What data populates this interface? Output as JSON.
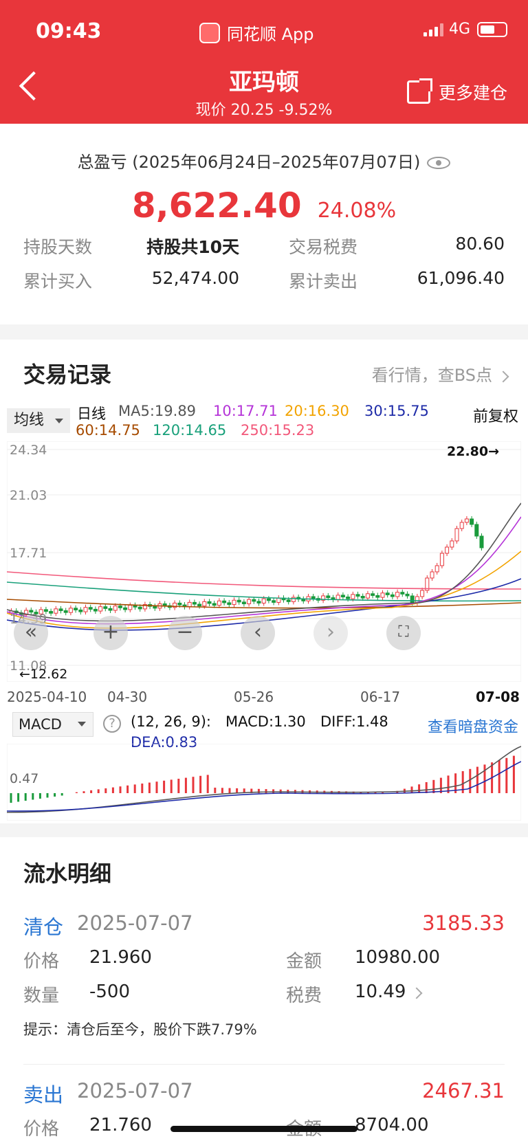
{
  "status": {
    "time": "09:43",
    "app": "同花顺 App",
    "network": "4G"
  },
  "nav": {
    "title": "亚玛顿",
    "subtitle": "现价 20.25 -9.52%",
    "more": "更多建仓"
  },
  "summary": {
    "title": "总盈亏 (2025年06月24日–2025年07月07日)",
    "amount": "8,622.40",
    "pct": "24.08%",
    "rows": [
      {
        "l1": "持股天数",
        "v1": "持股共10天",
        "l2": "交易税费",
        "v2": "80.60"
      },
      {
        "l1": "累计买入",
        "v1": "52,474.00",
        "l2": "累计卖出",
        "v2": "61,096.40"
      }
    ]
  },
  "records_section": {
    "title": "交易记录",
    "link": "看行情，查BS点"
  },
  "kline": {
    "ma_type": "均线",
    "period": "日线",
    "ma5": "MA5:19.89",
    "ma10": "10:17.71",
    "ma20": "20:16.30",
    "ma30": "30:15.75",
    "ma60": "60:14.75",
    "ma120": "120:14.65",
    "ma250": "250:15.23",
    "adjust": "前复权",
    "ticks": [
      "24.34",
      "21.03",
      "17.71",
      "14.39",
      "11.08"
    ],
    "high_mark": "22.80→",
    "low_mark": "←12.62",
    "dates": [
      "2025-04-10",
      "04-30",
      "05-26",
      "06-17",
      "07-08"
    ],
    "colors": {
      "up": "#e8363b",
      "down": "#1a9b3c",
      "ma5": "#555555",
      "ma10": "#b534d8",
      "ma20": "#f2a300",
      "ma30": "#1e2ba8",
      "ma60": "#a64b00",
      "ma120": "#18a07a",
      "ma250": "#f2587a"
    }
  },
  "macd": {
    "type": "MACD",
    "params": "(12, 26, 9):",
    "macd": "MACD:1.30",
    "diff": "DIFF:1.48",
    "dea": "DEA:0.83",
    "link": "查看暗盘资金",
    "tick": "0.47"
  },
  "flow": {
    "title": "流水明细",
    "records": [
      {
        "type": "清仓",
        "date": "2025-07-07",
        "pl": "3185.33",
        "price_label": "价格",
        "price": "21.960",
        "amount_label": "金额",
        "amount": "10980.00",
        "qty_label": "数量",
        "qty": "-500",
        "fee_label": "税费",
        "fee": "10.49",
        "tip": "提示：清仓后至今，股价下跌7.79%"
      },
      {
        "type": "卖出",
        "date": "2025-07-07",
        "pl": "2467.31",
        "price_label": "价格",
        "price": "21.760",
        "amount_label": "金额",
        "amount": "8704.00"
      }
    ]
  }
}
